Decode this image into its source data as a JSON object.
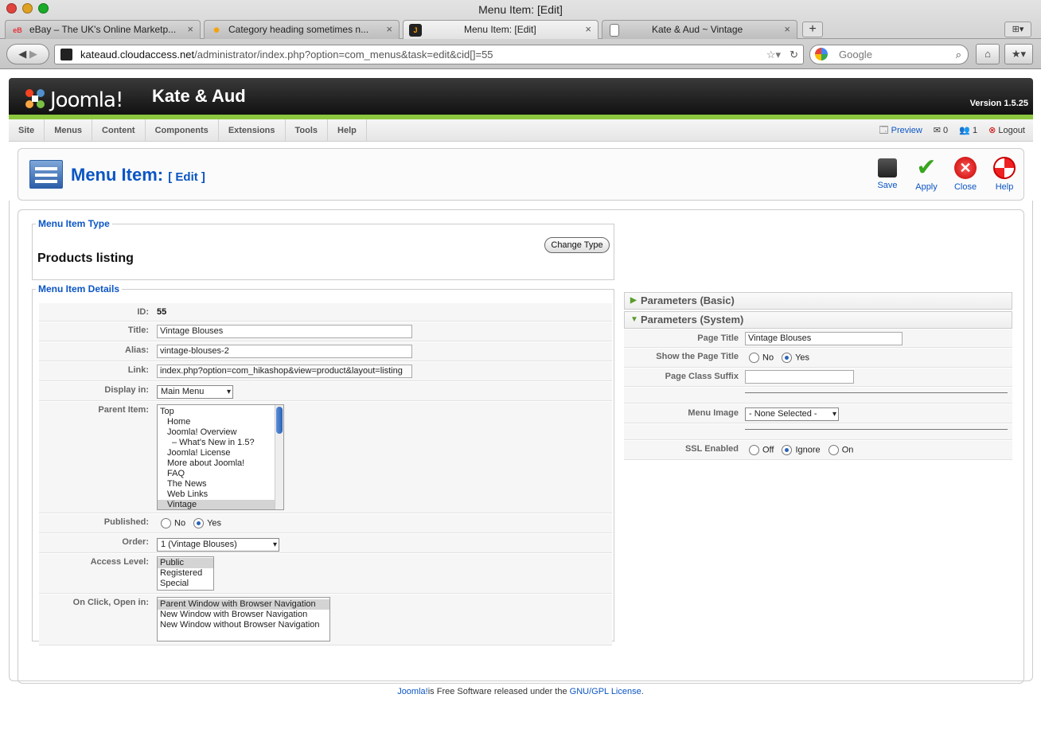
{
  "window": {
    "title": "Menu Item: [Edit]"
  },
  "tabs": [
    {
      "label": "eBay – The UK's Online Marketp...",
      "icon": "ebay-favicon"
    },
    {
      "label": "Category heading sometimes n...",
      "icon": "sun-favicon"
    },
    {
      "label": "Menu Item: [Edit]",
      "icon": "joomla-favicon"
    },
    {
      "label": "Kate & Aud ~ Vintage",
      "icon": "page-favicon"
    }
  ],
  "nav": {
    "url_domain": "kateaud.cloudaccess.net",
    "url_path": "/administrator/index.php?option=com_menus&task=edit&cid[]=55",
    "search_placeholder": "Google"
  },
  "header": {
    "brand": "Joomla!",
    "site_name": "Kate & Aud",
    "version": "Version 1.5.25"
  },
  "menubar": {
    "items": [
      "Site",
      "Menus",
      "Content",
      "Components",
      "Extensions",
      "Tools",
      "Help"
    ],
    "preview": "Preview",
    "messages_count": "0",
    "users_count": "1",
    "logout": "Logout"
  },
  "toolbar": {
    "title": "Menu Item:",
    "subtitle": "[ Edit ]",
    "save": "Save",
    "apply": "Apply",
    "close": "Close",
    "help": "Help"
  },
  "type_section": {
    "legend": "Menu Item Type",
    "type_name": "Products listing",
    "change_button": "Change Type"
  },
  "details": {
    "legend": "Menu Item Details",
    "id_label": "ID:",
    "id_value": "55",
    "title_label": "Title:",
    "title_value": "Vintage Blouses",
    "alias_label": "Alias:",
    "alias_value": "vintage-blouses-2",
    "link_label": "Link:",
    "link_value": "index.php?option=com_hikashop&view=product&layout=listing",
    "display_label": "Display in:",
    "display_value": "Main Menu",
    "parent_label": "Parent Item:",
    "parent_items": [
      "Top",
      "   Home",
      "   Joomla! Overview",
      "      – What's New in 1.5?",
      "   Joomla! License",
      "   More about Joomla!",
      "   FAQ",
      "   The News",
      "   Web Links",
      "   Vintage"
    ],
    "published_label": "Published:",
    "no": "No",
    "yes": "Yes",
    "order_label": "Order:",
    "order_value": "1 (Vintage Blouses)",
    "access_label": "Access Level:",
    "access_options": [
      "Public",
      "Registered",
      "Special"
    ],
    "onclick_label": "On Click, Open in:",
    "onclick_options": [
      "Parent Window with Browser Navigation",
      "New Window with Browser Navigation",
      "New Window without Browser Navigation"
    ]
  },
  "params": {
    "basic_title": "Parameters (Basic)",
    "system_title": "Parameters (System)",
    "page_title_label": "Page Title",
    "page_title_value": "Vintage Blouses",
    "show_title_label": "Show the Page Title",
    "no": "No",
    "yes": "Yes",
    "suffix_label": "Page Class Suffix",
    "suffix_value": "",
    "menu_image_label": "Menu Image",
    "menu_image_value": "- None Selected -",
    "ssl_label": "SSL Enabled",
    "ssl_off": "Off",
    "ssl_ignore": "Ignore",
    "ssl_on": "On"
  },
  "footer": {
    "link1": "Joomla!",
    "middle": " is Free Software released under the ",
    "link2": "GNU/GPL License",
    "end": "."
  }
}
